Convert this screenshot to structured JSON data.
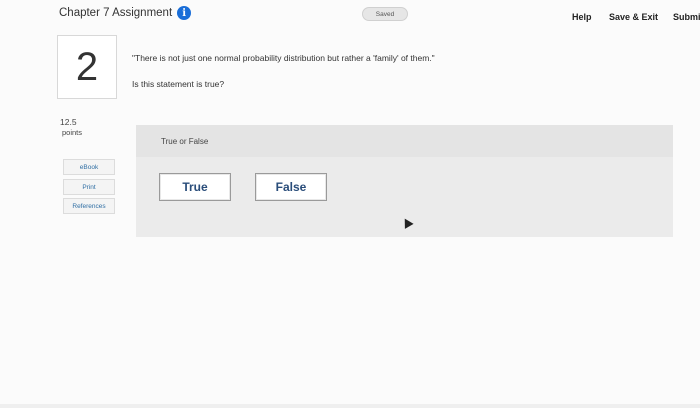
{
  "header": {
    "title": "Chapter 7 Assignment",
    "info_icon": "i",
    "saved_label": "Saved",
    "help_label": "Help",
    "save_exit_label": "Save & Exit",
    "submit_label": "Submit"
  },
  "question": {
    "number": "2",
    "points_value": "12.5",
    "points_label": "points",
    "text": "\"There is not just one normal probability distribution but rather a 'family' of them.\"",
    "prompt": "Is this statement is true?"
  },
  "resources": {
    "ebook_label": "eBook",
    "print_label": "Print",
    "references_label": "References"
  },
  "answer": {
    "type_label": "True or False",
    "options": [
      "True",
      "False"
    ]
  },
  "colors": {
    "info_icon": "#1a6ed8",
    "answer_text": "#2a4d7a",
    "resource_link": "#2f6ea3",
    "panel_bg": "#ebebeb"
  },
  "icons": {
    "info": "info-icon",
    "cursor": "mouse-cursor-icon"
  }
}
